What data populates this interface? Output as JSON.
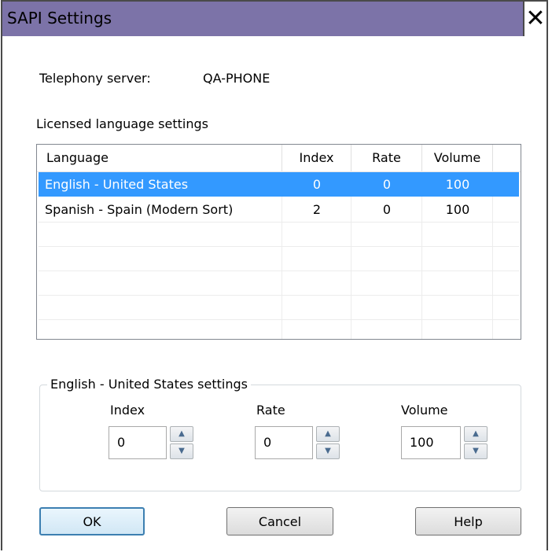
{
  "window": {
    "title": "SAPI Settings",
    "close_glyph": "✕"
  },
  "server": {
    "label": "Telephony server:",
    "value": "QA-PHONE"
  },
  "licensed": {
    "section_label": "Licensed language settings",
    "columns": [
      "Language",
      "Index",
      "Rate",
      "Volume"
    ],
    "rows": [
      {
        "language": "English - United States",
        "index": "0",
        "rate": "0",
        "volume": "100",
        "selected": true
      },
      {
        "language": "Spanish - Spain (Modern Sort)",
        "index": "2",
        "rate": "0",
        "volume": "100",
        "selected": false
      }
    ],
    "selection_color": "#3399ff"
  },
  "settings": {
    "group_label": "English - United States settings",
    "index": {
      "label": "Index",
      "value": "0"
    },
    "rate": {
      "label": "Rate",
      "value": "0"
    },
    "volume": {
      "label": "Volume",
      "value": "100"
    },
    "spin_up": "▲",
    "spin_down": "▼"
  },
  "buttons": {
    "ok": "OK",
    "cancel": "Cancel",
    "help": "Help"
  },
  "colors": {
    "title_bar": "#7c73a8",
    "default_button_border": "#3c7fb1"
  },
  "icons": {
    "close": "close-icon",
    "spin_up": "chevron-up-icon",
    "spin_down": "chevron-down-icon"
  }
}
